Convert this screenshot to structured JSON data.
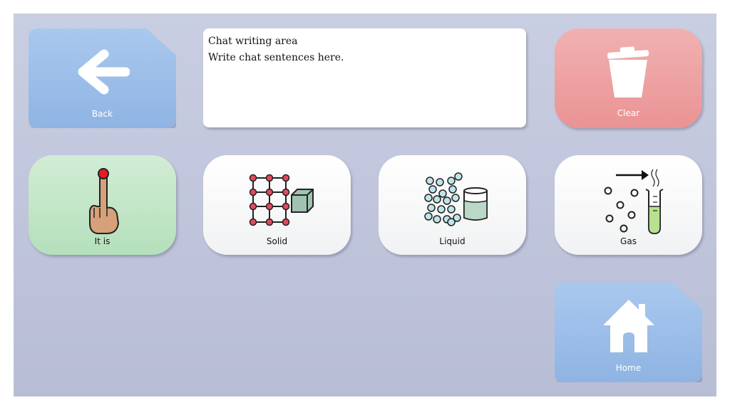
{
  "chat": {
    "line1": "Chat writing area",
    "line2": "Write chat sentences here."
  },
  "buttons": {
    "back": {
      "label": "Back",
      "icon": "arrow-left-icon"
    },
    "clear": {
      "label": "Clear",
      "icon": "trash-icon"
    },
    "it_is": {
      "label": "It is",
      "icon": "pointing-finger-icon"
    },
    "solid": {
      "label": "Solid",
      "icon": "solid-lattice-icon"
    },
    "liquid": {
      "label": "Liquid",
      "icon": "liquid-beaker-icon"
    },
    "gas": {
      "label": "Gas",
      "icon": "gas-test-tube-icon"
    },
    "home": {
      "label": "Home",
      "icon": "house-icon"
    }
  },
  "colors": {
    "background": "#bfc4dc",
    "nav_blue": "#9dbfea",
    "clear_red": "#ee9fa0",
    "phrase_green": "#c2e6c8",
    "word_white": "#f8f8f8"
  }
}
